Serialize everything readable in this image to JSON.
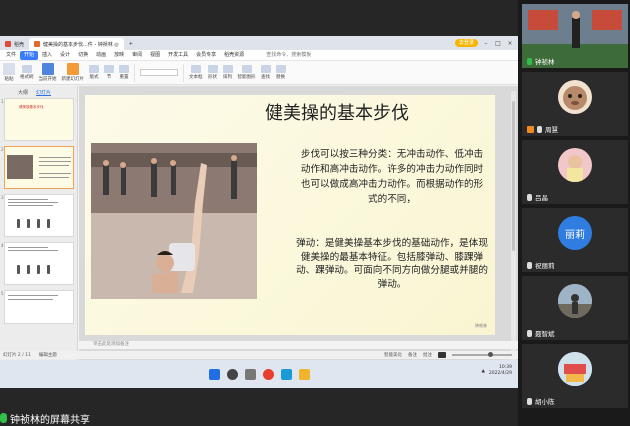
{
  "browser": {
    "tabs": [
      {
        "label": "稻壳",
        "color": "#e24b3c"
      },
      {
        "label": "健美操的基本步伐...件 - 钟祯林 ◎",
        "color": "#e06a2b"
      }
    ],
    "pill_label": "去登录"
  },
  "menu": {
    "items": [
      "文件",
      "开始",
      "插入",
      "设计",
      "切换",
      "动画",
      "放映",
      "审阅",
      "视图",
      "开发工具",
      "会员专享",
      "稻壳资源"
    ],
    "active_index": 1,
    "search": "查找命令、搜索模板"
  },
  "ribbon": {
    "buttons": [
      "粘贴",
      "格式刷",
      "当前开始",
      "新建幻灯片",
      "版式",
      "节",
      "重置",
      "文本框",
      "形状",
      "排列",
      "智能图形",
      "查找",
      "替换"
    ]
  },
  "left_panel": {
    "tabs": [
      "大纲",
      "幻灯片"
    ],
    "active_tab": 1,
    "thumb_title": "健美操基本步伐",
    "thumb_numbers": [
      "1",
      "2",
      "3",
      "4",
      "5"
    ],
    "add_label": "+"
  },
  "slide": {
    "title": "健美操的基本步伐",
    "paragraph1": "步伐可以按三种分类：无冲击动作、低冲击动作和高冲击动作。许多的冲击力动作同时也可以做成高冲击力动作。而根据动作的形式的不同，",
    "paragraph2": "弹动：是健美操基本步伐的基础动作，是体现健美操的最基本特征。包括膝弹动、膝踝弹动、踝弹动。可面向不同方向做分腿或并腿的弹动。",
    "footer": "钟祯林"
  },
  "notes_placeholder": "单击此处添加备注",
  "status": {
    "slide_counter": "幻灯片 2 / 11",
    "theme": "编辑主题",
    "right_items": [
      "智能美化",
      "备注",
      "批注"
    ]
  },
  "clock": {
    "time": "10:39",
    "date": "2022/4/29"
  },
  "share_label": "钟祯林的屏幕共享",
  "participants": [
    {
      "name": "钟祯林",
      "mic": "green"
    },
    {
      "name": "周慧",
      "mic": "white",
      "owner": true
    },
    {
      "name": "吕晶",
      "mic": "white"
    },
    {
      "name": "祝丽莉",
      "mic": "white",
      "avatar_text": "丽莉"
    },
    {
      "name": "聂智斌",
      "mic": "white"
    },
    {
      "name": "胡小陈",
      "mic": "white"
    }
  ]
}
